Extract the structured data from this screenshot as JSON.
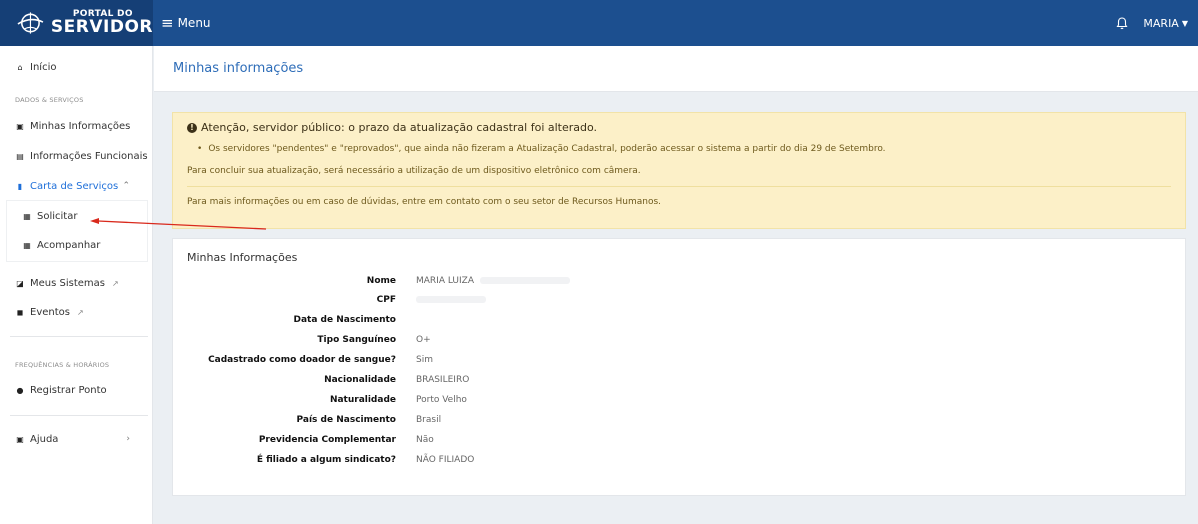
{
  "header": {
    "logo_small": "PORTAL DO",
    "logo_big": "SERVIDOR",
    "menu_label": "Menu",
    "user_name": "MARIA",
    "brand_color": "#1c4f8f"
  },
  "sidebar": {
    "inicio": "Início",
    "section_dados": "DADOS & SERVIÇOS",
    "minhas_info": "Minhas Informações",
    "info_funcionais": "Informações Funcionais",
    "carta_servicos": "Carta de Serviços",
    "solicitar": "Solicitar",
    "acompanhar": "Acompanhar",
    "meus_sistemas": "Meus Sistemas",
    "eventos": "Eventos",
    "section_freq": "FREQUÊNCIAS & HORÁRIOS",
    "registrar_ponto": "Registrar Ponto",
    "ajuda": "Ajuda"
  },
  "page": {
    "title": "Minhas informações"
  },
  "alert": {
    "title": "Atenção, servidor público: o prazo da atualização cadastral foi alterado.",
    "bullet": "Os servidores \"pendentes\" e \"reprovados\", que ainda não fizeram a Atualização Cadastral, poderão acessar o sistema a partir do dia 29 de Setembro.",
    "paragraph": "Para concluir sua atualização, será necessário a utilização de um dispositivo eletrônico com câmera.",
    "contact": "Para mais informações ou em caso de dúvidas, entre em contato com o seu setor de Recursos Humanos."
  },
  "card": {
    "title": "Minhas Informações",
    "rows": [
      {
        "label": "Nome",
        "value": "MARIA LUIZA"
      },
      {
        "label": "CPF",
        "value": ""
      },
      {
        "label": "Data de Nascimento",
        "value": ""
      },
      {
        "label": "Tipo Sanguíneo",
        "value": "O+"
      },
      {
        "label": "Cadastrado como doador de sangue?",
        "value": "Sim"
      },
      {
        "label": "Nacionalidade",
        "value": "BRASILEIRO"
      },
      {
        "label": "Naturalidade",
        "value": "Porto Velho"
      },
      {
        "label": "País de Nascimento",
        "value": "Brasil"
      },
      {
        "label": "Previdencia Complementar",
        "value": "Não"
      },
      {
        "label": "É filiado a algum sindicato?",
        "value": "NÃO FILIADO"
      }
    ]
  }
}
